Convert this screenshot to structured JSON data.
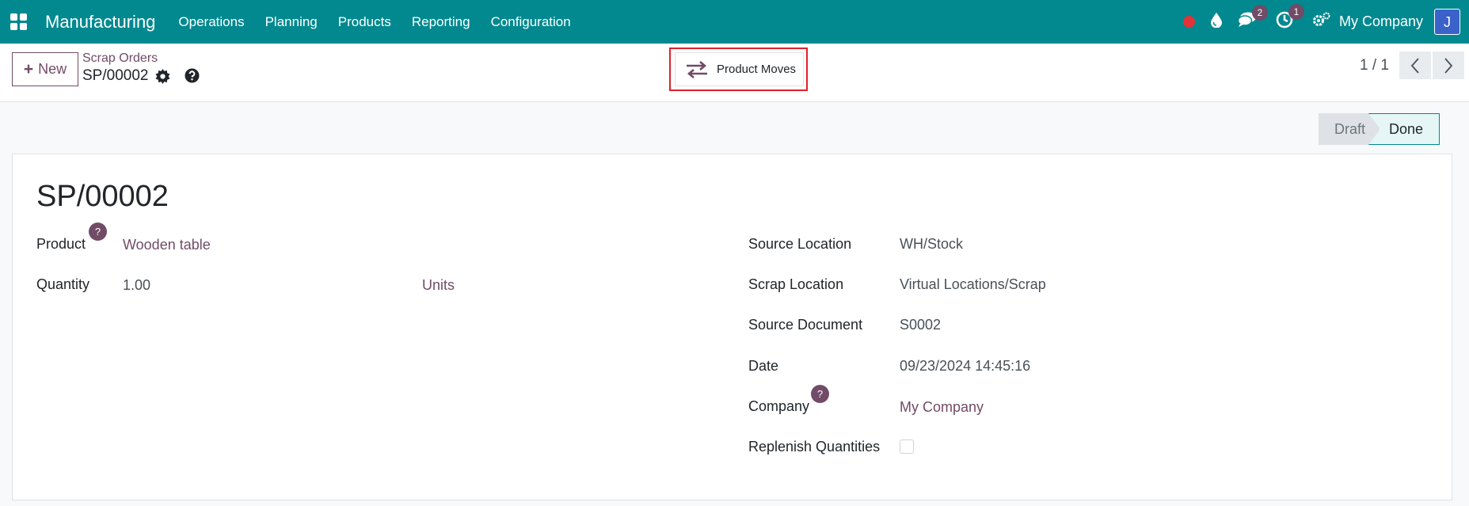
{
  "nav": {
    "app_name": "Manufacturing",
    "menu": [
      "Operations",
      "Planning",
      "Products",
      "Reporting",
      "Configuration"
    ],
    "messages_count": "2",
    "activities_count": "1",
    "company": "My Company",
    "avatar_initial": "J"
  },
  "control": {
    "new_label": "New",
    "breadcrumb": "Scrap Orders",
    "record_name": "SP/00002",
    "smart_button_label": "Product Moves",
    "pager": "1 / 1"
  },
  "status": {
    "stages": [
      "Draft",
      "Done"
    ],
    "current": "Done"
  },
  "form": {
    "title": "SP/00002",
    "product_label": "Product",
    "product_value": "Wooden table",
    "quantity_label": "Quantity",
    "quantity_value": "1.00",
    "uom_value": "Units",
    "source_location_label": "Source Location",
    "source_location_value": "WH/Stock",
    "scrap_location_label": "Scrap Location",
    "scrap_location_value": "Virtual Locations/Scrap",
    "source_document_label": "Source Document",
    "source_document_value": "S0002",
    "date_label": "Date",
    "date_value": "09/23/2024 14:45:16",
    "company_label": "Company",
    "company_value": "My Company",
    "replenish_label": "Replenish Quantities",
    "help_mark": "?"
  },
  "colors": {
    "navbar": "#01898f",
    "accent": "#714b67",
    "highlight": "#e0202a"
  }
}
